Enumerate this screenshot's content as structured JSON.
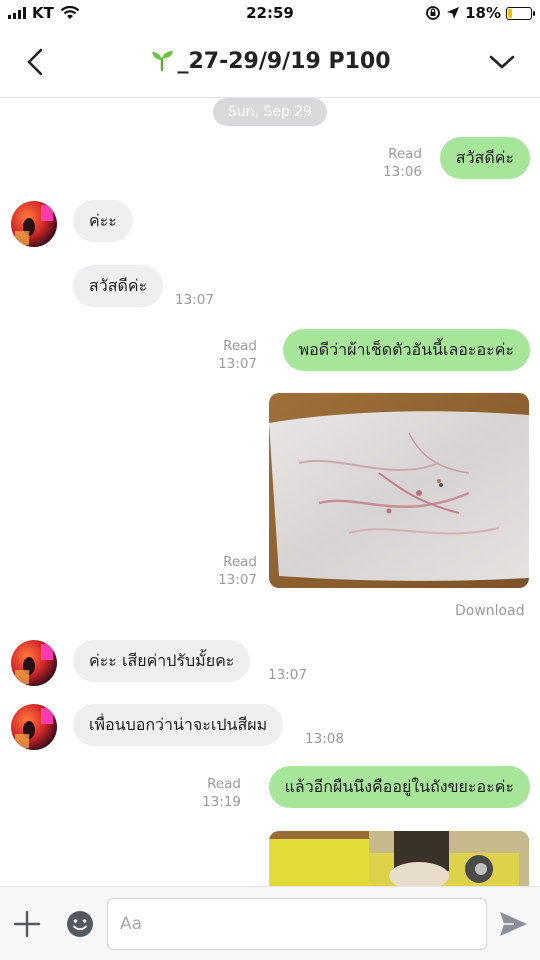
{
  "status_bar": {
    "carrier": "KT",
    "time": "22:59",
    "battery_percent": "18%",
    "battery_level": 0.18,
    "icons": [
      "signal-icon",
      "wifi-icon",
      "orientation-lock-icon",
      "location-icon",
      "battery-icon"
    ]
  },
  "header": {
    "title": "_27-29/9/19 P100",
    "title_prefix_icon": "sprout-icon",
    "back_icon": "chevron-left-icon",
    "menu_icon": "chevron-down-icon"
  },
  "chat": {
    "date_divider": "Sun, Sep 29",
    "messages": [
      {
        "id": "m1",
        "side": "out",
        "text": "สวัสดีค่ะ",
        "status": "Read",
        "time": "13:06"
      },
      {
        "id": "m2",
        "side": "in",
        "text": "ค่ะะ",
        "time": ""
      },
      {
        "id": "m3",
        "side": "in",
        "text": "สวัสดีค่ะ",
        "time": "13:07"
      },
      {
        "id": "m4",
        "side": "out",
        "text": "พอดีว่าผ้าเช็ดตัวอันนี้เลอะอะค่ะ",
        "status": "Read",
        "time": "13:07"
      },
      {
        "id": "m5",
        "side": "out",
        "type": "image",
        "status": "Read",
        "time": "13:07",
        "action": "Download"
      },
      {
        "id": "m6",
        "side": "in",
        "text": "ค่ะะ เสียค่าปรับมั้ยคะ",
        "time": "13:07"
      },
      {
        "id": "m7",
        "side": "in",
        "text": "เพื่อนบอกว่าน่าจะเปนสีผม",
        "time": "13:08"
      },
      {
        "id": "m8",
        "side": "out",
        "text": "แล้วอีกผืนนึงคืออยู่ในถังขยะอะค่ะ",
        "status": "Read",
        "time": "13:19"
      },
      {
        "id": "m9",
        "side": "out",
        "type": "image"
      }
    ]
  },
  "input_bar": {
    "placeholder": "Aa",
    "value": "",
    "icons": [
      "plus-icon",
      "emoji-icon",
      "send-icon"
    ]
  },
  "colors": {
    "outgoing_bubble": "#a6e59a",
    "incoming_bubble": "#efeff1",
    "meta_text": "#9a9a9e",
    "date_pill": "#d9d9dc",
    "send_icon": "#8a8f99"
  }
}
